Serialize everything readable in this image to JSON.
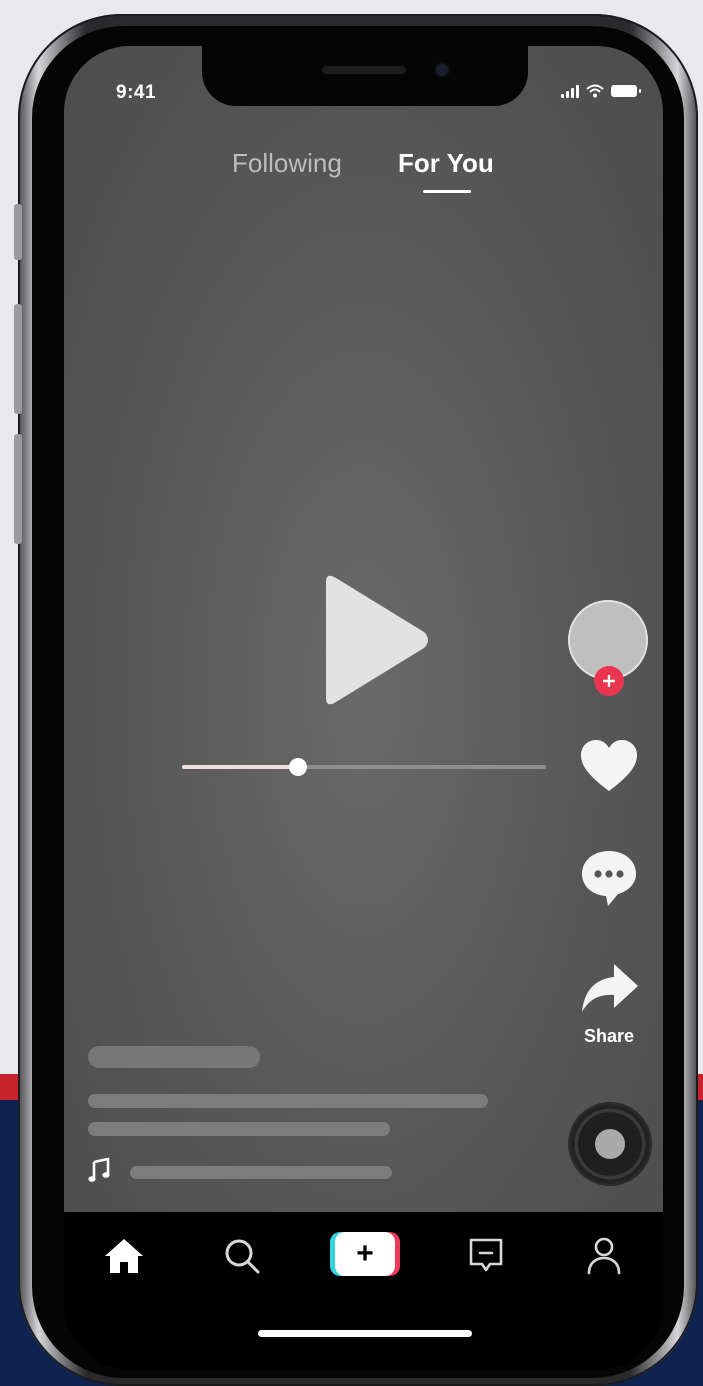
{
  "status_bar": {
    "time": "9:41"
  },
  "top_tabs": {
    "following": "Following",
    "for_you": "For You",
    "active": "For You"
  },
  "video": {
    "progress": 0.32
  },
  "actions": {
    "share_label": "Share"
  },
  "colors": {
    "accent_red": "#ea3550",
    "accent_cyan": "#35d3de",
    "video_bg": "#575757",
    "nav_bg": "#000000"
  },
  "icons": {
    "home": "home-icon",
    "search": "search-icon",
    "create": "plus-icon",
    "inbox": "inbox-icon",
    "profile": "profile-icon",
    "like": "heart-icon",
    "comment": "comment-icon",
    "share": "share-icon",
    "play": "play-icon",
    "music": "music-note-icon"
  }
}
